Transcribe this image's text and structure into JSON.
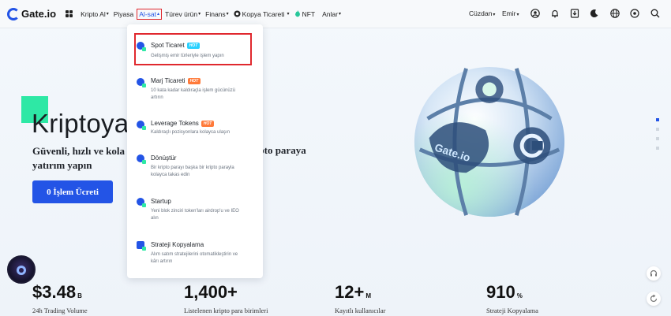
{
  "nav": {
    "logo": "Gate.io",
    "items": [
      {
        "label": "Kripto Al",
        "caret": "▾"
      },
      {
        "label": "Piyasa",
        "caret": ""
      },
      {
        "label": "Al-sat",
        "caret": "▴"
      },
      {
        "label": "Türev ürün",
        "caret": "▾"
      },
      {
        "label": "Finans",
        "caret": "▾"
      },
      {
        "label": "Kopya Ticareti",
        "caret": "▾"
      },
      {
        "label": "NFT",
        "caret": ""
      },
      {
        "label": "Anlar",
        "caret": "▾"
      }
    ],
    "wallet": "Cüzdan",
    "orders": "Emir"
  },
  "hero": {
    "title": "Kriptoya A",
    "subtitle_left": "Güvenli, hızlı ve kola",
    "subtitle_right": "ripto paraya",
    "subtitle_line2": "yatırım yapın",
    "cta": "0 İşlem Ücreti",
    "orb_label": "Gate.io"
  },
  "dropdown": {
    "items": [
      {
        "title": "Spot Ticaret",
        "badge": "HOT",
        "badge_color": "#2ad1ff",
        "desc": "Gelişmiş emir türleriyle işlem yapın"
      },
      {
        "title": "Marj Ticareti",
        "badge": "HOT",
        "badge_color": "#ff7a3a",
        "desc": "10 kata kadar kaldıraçla işlem gücünüzü artırın"
      },
      {
        "title": "Leverage Tokens",
        "badge": "HOT",
        "badge_color": "#ff7a3a",
        "desc": "Kaldıraçlı pozisyonlara kolayca ulaşın"
      },
      {
        "title": "Dönüştür",
        "badge": "",
        "badge_color": "",
        "desc": "Bir kripto parayı başka bir kripto parayla kolayca takas edin"
      },
      {
        "title": "Startup",
        "badge": "",
        "badge_color": "",
        "desc": "Yeni blok zinciri token'ları airdrop'u ve IEO alın"
      },
      {
        "title": "Strateji Kopyalama",
        "badge": "",
        "badge_color": "",
        "desc": "Alım satım stratejilerini otomatikleştirin ve kârı artırın"
      }
    ]
  },
  "stats": [
    {
      "value": "$3.48",
      "unit": "B",
      "label": "24h Trading Volume"
    },
    {
      "value": "1,400+",
      "unit": "",
      "label": "Listelenen kripto para birimleri"
    },
    {
      "value": "12+",
      "unit": "M",
      "label": "Kayıtlı kullanıcılar"
    },
    {
      "value": "910",
      "unit": "%",
      "label": "Strateji Kopyalama"
    }
  ],
  "colors": {
    "accent": "#2354e6",
    "green": "#2ee8a5",
    "highlight": "#e0282e"
  }
}
